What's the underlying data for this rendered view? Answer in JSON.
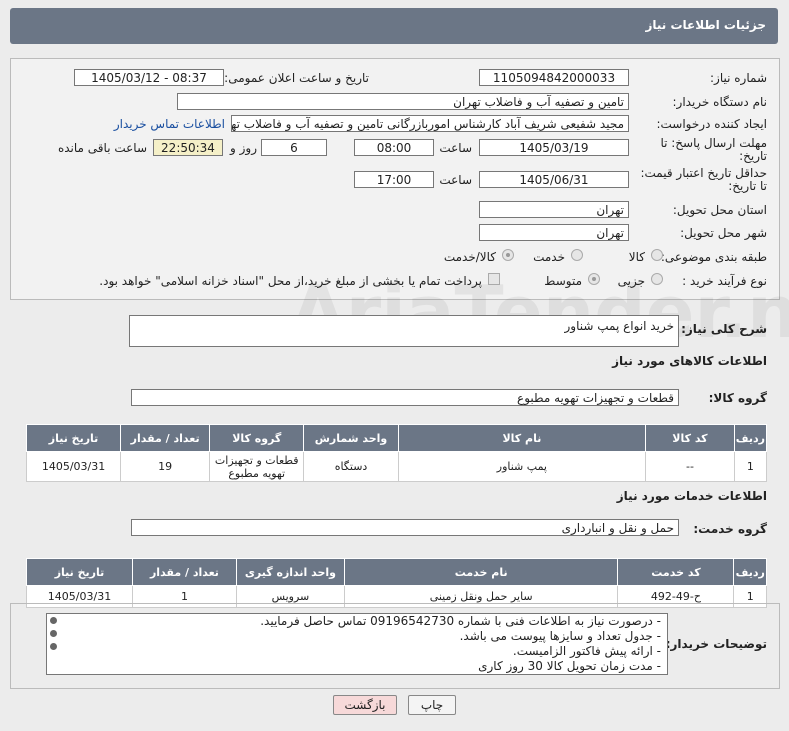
{
  "header": {
    "title": "جزئیات اطلاعات نیاز"
  },
  "form": {
    "need_number_label": "شماره نیاز:",
    "need_number": "1105094842000033",
    "announce_label": "تاریخ و ساعت اعلان عمومی:",
    "announce_value": "1405/03/12 - 08:37",
    "buyer_org_label": "نام دستگاه خریدار:",
    "buyer_org": "تامین و تصفیه آب و فاضلاب تهران",
    "creator_label": "ایجاد کننده درخواست:",
    "creator": "مجید شفیعی شریف آباد کارشناس اموربازرگانی تامین و تصفیه آب و فاضلاب تهران",
    "contact_link": "اطلاعات تماس خریدار",
    "reply_deadline_label": "مهلت ارسال پاسخ: تا تاریخ:",
    "reply_date": "1405/03/19",
    "time_label": "ساعت",
    "reply_time": "08:00",
    "days_value": "6",
    "days_label": "روز و",
    "remaining_time": "22:50:34",
    "remaining_label": "ساعت باقی مانده",
    "validity_label": "حداقل تاریخ اعتبار قیمت: تا تاریخ:",
    "validity_date": "1405/06/31",
    "validity_time": "17:00",
    "province_label": "استان محل تحویل:",
    "province": "تهران",
    "city_label": "شهر محل تحویل:",
    "city": "تهران",
    "category_label": "طبقه بندی موضوعی:",
    "category_options": [
      "کالا",
      "خدمت",
      "کالا/خدمت"
    ],
    "process_label": "نوع فرآیند خرید :",
    "process_options": [
      "جزیی",
      "متوسط"
    ],
    "payment_note": "پرداخت تمام یا بخشی از مبلغ خرید،از محل \"اسناد خزانه اسلامی\" خواهد بود."
  },
  "summary": {
    "label": "شرح کلی نیاز:",
    "value": "خرید انواع پمپ شناور"
  },
  "goods": {
    "section_title": "اطلاعات کالاهای مورد نیاز",
    "group_label": "گروه کالا:",
    "group_value": "قطعات و تجهیزات تهویه مطبوع",
    "headers": [
      "ردیف",
      "کد کالا",
      "نام کالا",
      "واحد شمارش",
      "گروه کالا",
      "تعداد / مقدار",
      "تاریخ نیاز"
    ],
    "rows": [
      {
        "row": "1",
        "code": "--",
        "name": "پمپ شناور",
        "unit": "دستگاه",
        "group": "قطعات و تجهیزات تهویه مطبوع",
        "qty": "19",
        "date": "1405/03/31"
      }
    ]
  },
  "services": {
    "section_title": "اطلاعات خدمات مورد نیاز",
    "group_label": "گروه خدمت:",
    "group_value": "حمل و نقل و انبارداری",
    "headers": [
      "ردیف",
      "کد خدمت",
      "نام خدمت",
      "واحد اندازه گیری",
      "تعداد / مقدار",
      "تاریخ نیاز"
    ],
    "rows": [
      {
        "row": "1",
        "code": "ح-49-492",
        "name": "سایر حمل ونقل زمینی",
        "unit": "سرویس",
        "qty": "1",
        "date": "1405/03/31"
      }
    ]
  },
  "notes": {
    "label": "توضیحات خریدار:",
    "lines": [
      "- درصورت نیاز به اطلاعات فنی با شماره 09196542730 تماس حاصل فرمایید.",
      "- جدول تعداد و سایزها پیوست می باشد.",
      "- ارائه پیش فاکتور الزامیست.",
      "- مدت زمان تحویل کالا 30 روز کاری"
    ]
  },
  "buttons": {
    "print": "چاپ",
    "back": "بازگشت"
  },
  "watermark": "AriaTender.net"
}
